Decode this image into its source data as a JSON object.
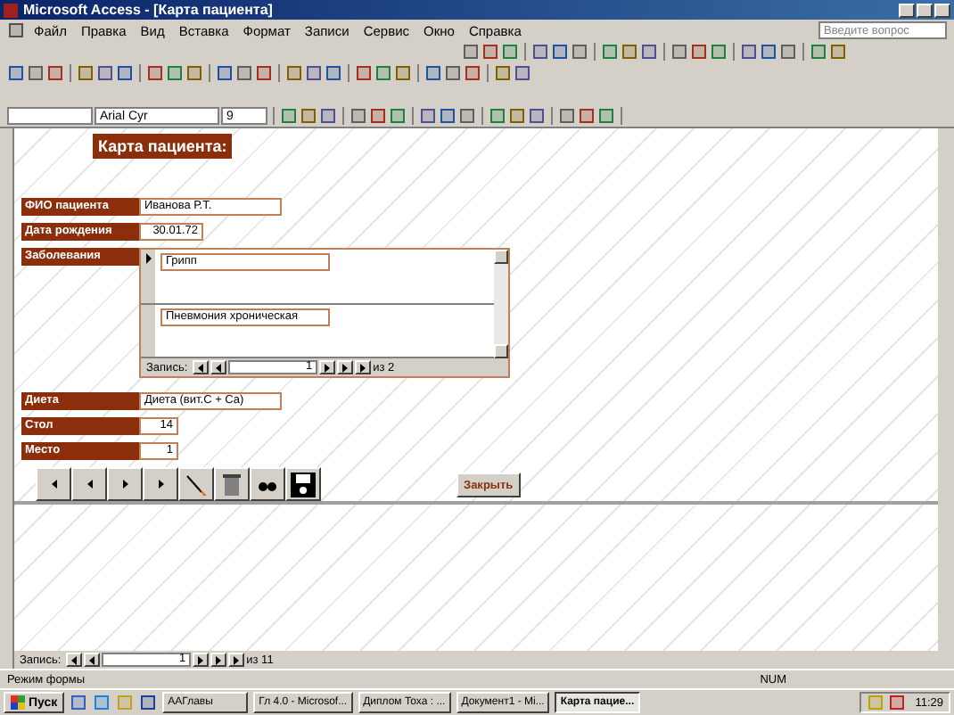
{
  "window": {
    "title": "Microsoft Access - [Карта пациента]"
  },
  "menu": {
    "items": [
      "Файл",
      "Правка",
      "Вид",
      "Вставка",
      "Формат",
      "Записи",
      "Сервис",
      "Окно",
      "Справка"
    ],
    "help_placeholder": "Введите вопрос"
  },
  "formatting": {
    "font": "Arial Cyr",
    "size": "9"
  },
  "form": {
    "title": "Карта пациента:",
    "fields_top": [
      {
        "label": "ФИО пациента",
        "value": "Иванова Р.Т.",
        "kind": "wide"
      },
      {
        "label": "Дата рождения",
        "value": "30.01.72",
        "kind": "narrow"
      }
    ],
    "subform": {
      "label": "Заболевания",
      "rows": [
        {
          "value": "Грипп",
          "selected": true
        },
        {
          "value": "Пневмония хроническая",
          "selected": false
        }
      ],
      "nav_label": "Запись:",
      "nav_value": "1",
      "nav_total": "из  2"
    },
    "fields_bottom": [
      {
        "label": "Диета",
        "value": "Диета (вит.C + Ca)",
        "kind": "wide"
      },
      {
        "label": "Стол",
        "value": "14",
        "kind": "short"
      },
      {
        "label": "Место",
        "value": "1",
        "kind": "short"
      }
    ],
    "close_button": "Закрыть"
  },
  "record_nav": {
    "label": "Запись:",
    "value": "1",
    "total": "из  11"
  },
  "status_bar": {
    "mode": "Режим формы",
    "num": "NUM"
  },
  "taskbar": {
    "start": "Пуск",
    "tasks": [
      {
        "label": "ААГлавы",
        "selected": false
      },
      {
        "label": "Гл 4.0 - Microsof...",
        "selected": false
      },
      {
        "label": "Диплом Тоха : ...",
        "selected": false
      },
      {
        "label": "Документ1 - Mi...",
        "selected": false
      },
      {
        "label": "Карта пацие...",
        "selected": true
      }
    ],
    "clock": "11:29"
  }
}
